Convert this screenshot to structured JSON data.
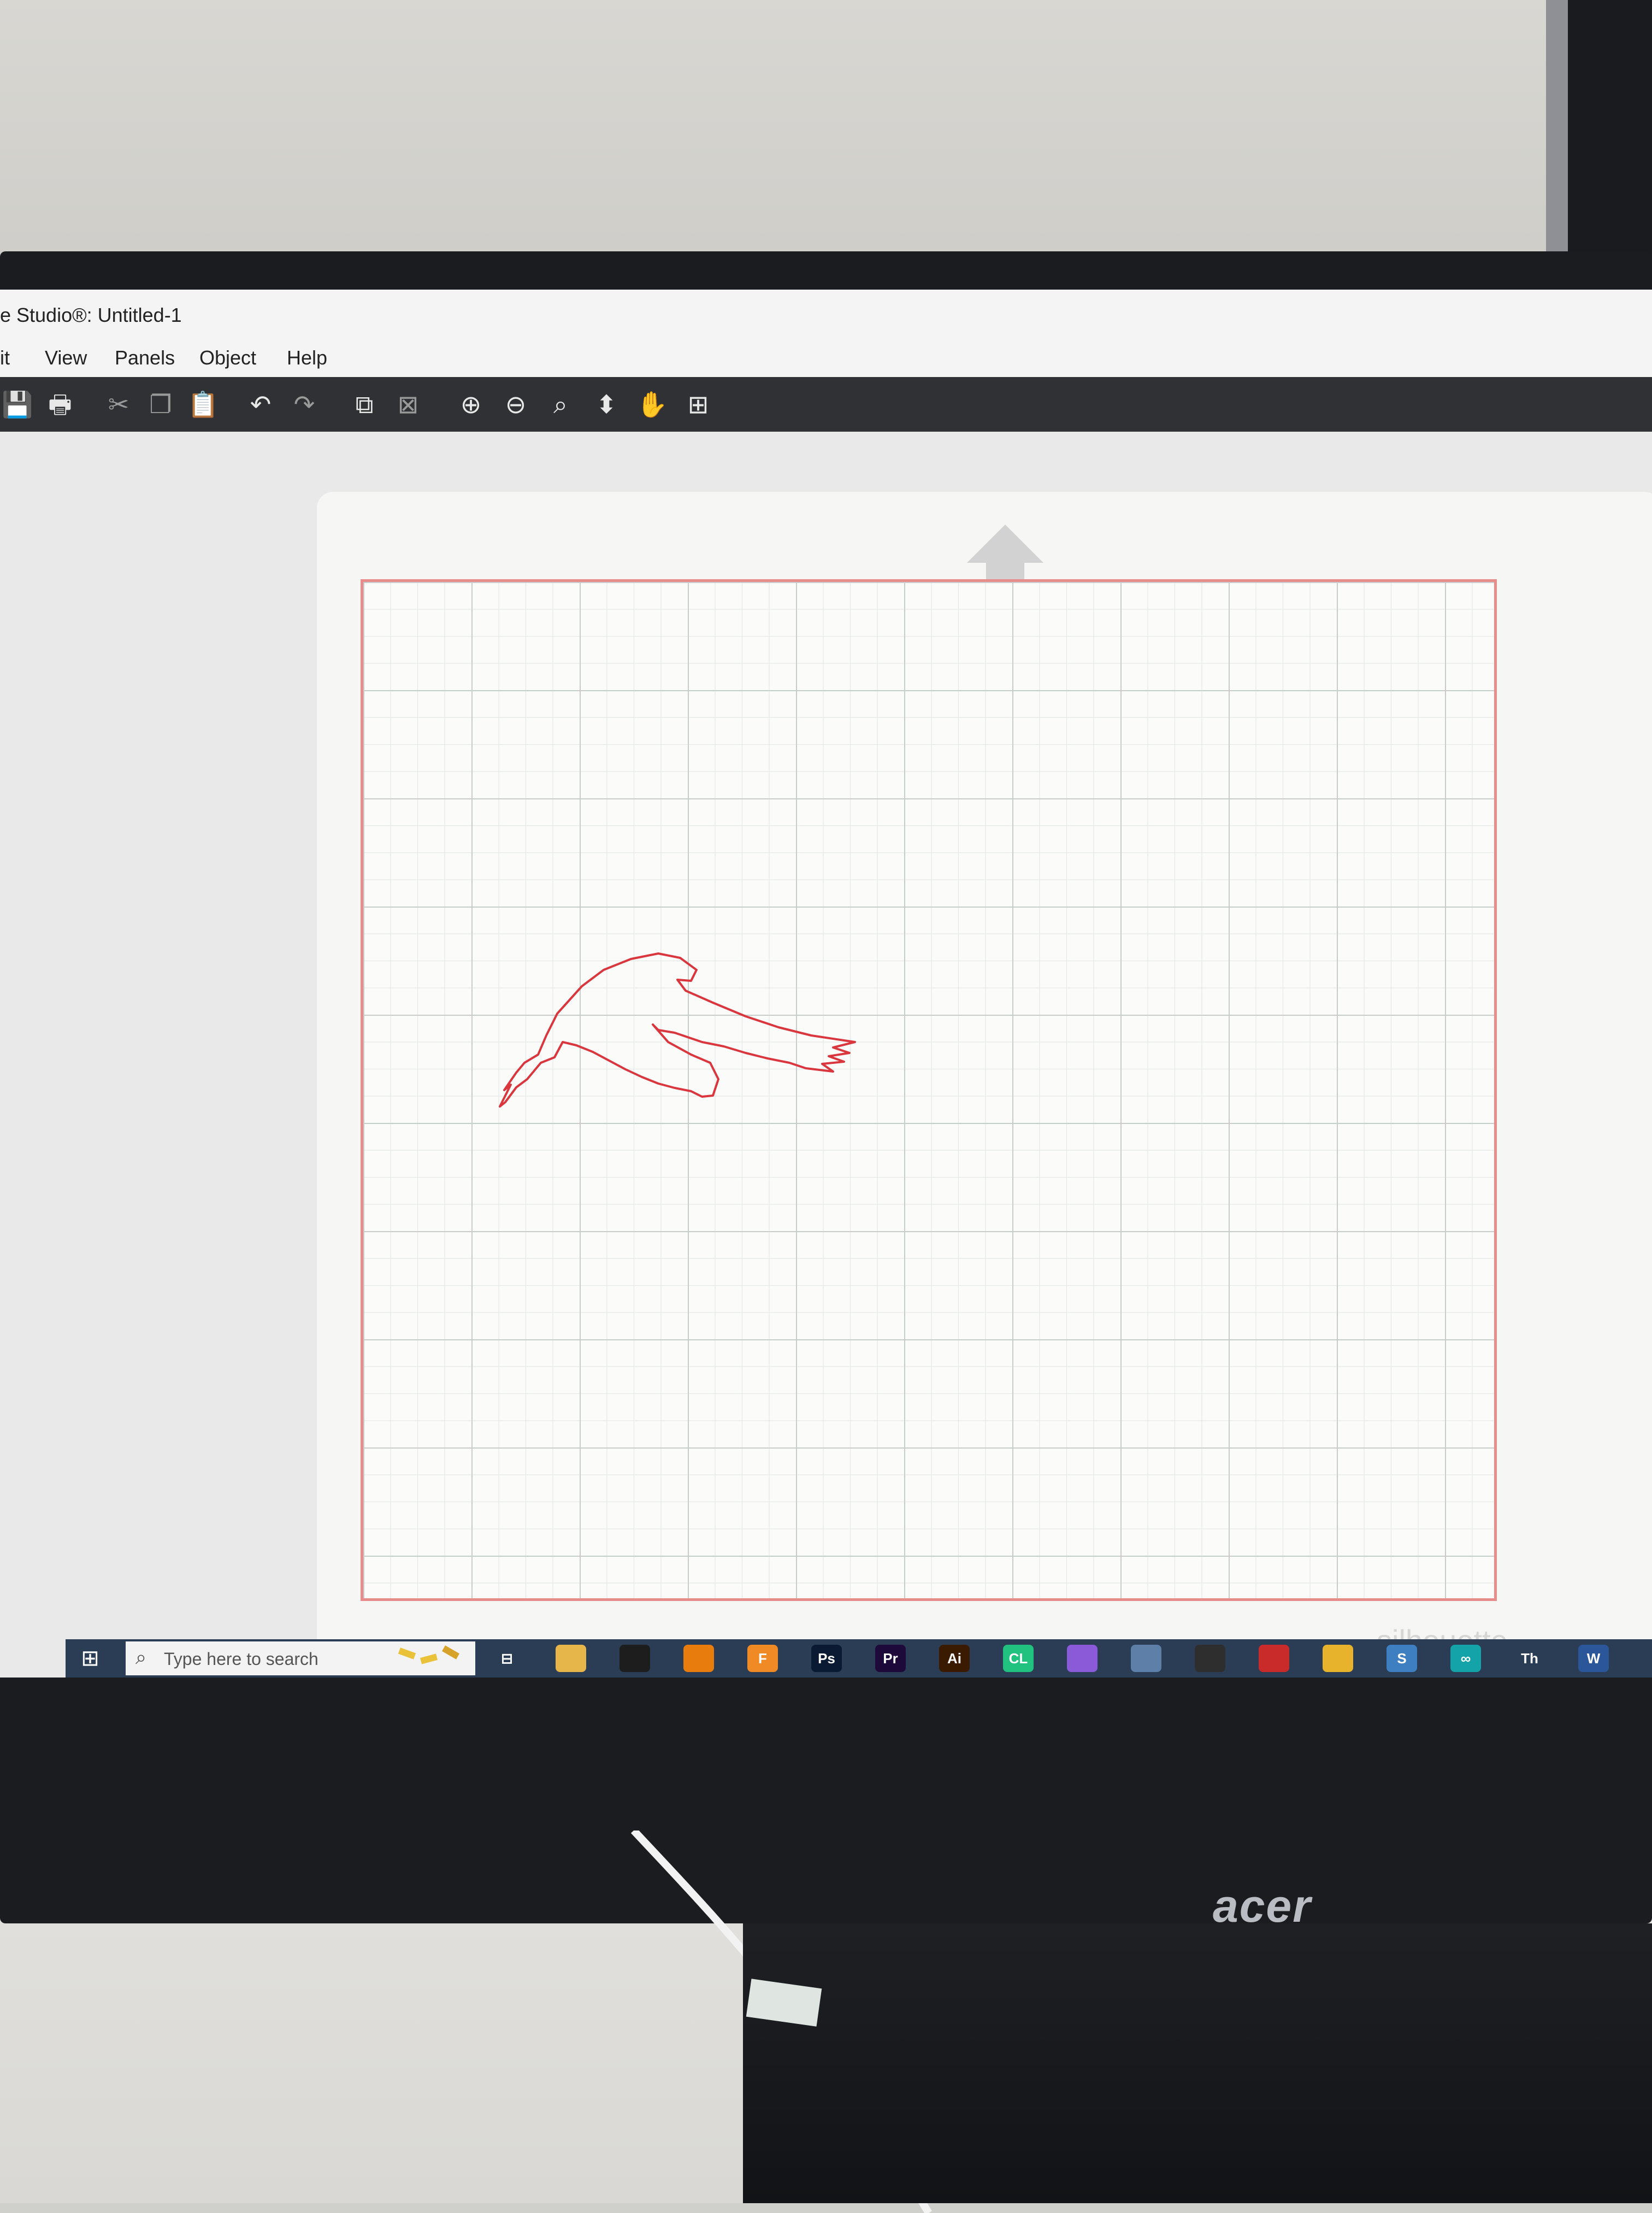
{
  "window": {
    "title": "e Studio®: Untitled-1"
  },
  "menu": {
    "items": [
      "it",
      "View",
      "Panels",
      "Object",
      "Help"
    ]
  },
  "toolbar": {
    "tools": [
      {
        "name": "save-icon",
        "glyph": "💾"
      },
      {
        "name": "print-icon",
        "glyph": "🖶"
      },
      {
        "name": "cut-icon",
        "glyph": "✂"
      },
      {
        "name": "copy-icon",
        "glyph": "❐"
      },
      {
        "name": "paste-icon",
        "glyph": "📋"
      },
      {
        "name": "undo-icon",
        "glyph": "↶"
      },
      {
        "name": "redo-icon",
        "glyph": "↷"
      },
      {
        "name": "group-icon",
        "glyph": "⧉"
      },
      {
        "name": "ungroup-icon",
        "glyph": "⊠"
      },
      {
        "name": "zoom-in-icon",
        "glyph": "⊕"
      },
      {
        "name": "zoom-out-icon",
        "glyph": "⊖"
      },
      {
        "name": "zoom-select-icon",
        "glyph": "⌕"
      },
      {
        "name": "fit-to-page-icon",
        "glyph": "⬍"
      },
      {
        "name": "pan-hand-icon",
        "glyph": "✋"
      },
      {
        "name": "fit-window-icon",
        "glyph": "⊞"
      }
    ]
  },
  "canvas": {
    "cut_line_color": "#d9363e",
    "shape": "flying bird outline"
  },
  "watermark": {
    "text": "silhouette"
  },
  "taskbar": {
    "search_placeholder": "Type here to search",
    "apps": [
      {
        "name": "task-view-icon",
        "label": "⊟",
        "color": "#2b3d55"
      },
      {
        "name": "file-explorer-icon",
        "label": "",
        "color": "#e7b64a"
      },
      {
        "name": "inkscape-icon",
        "label": "",
        "color": "#1d1d1d"
      },
      {
        "name": "blender-icon",
        "label": "",
        "color": "#e87d0d"
      },
      {
        "name": "fusion-icon",
        "label": "F",
        "color": "#f08a24"
      },
      {
        "name": "photoshop-icon",
        "label": "Ps",
        "color": "#0b1a33"
      },
      {
        "name": "premiere-icon",
        "label": "Pr",
        "color": "#1d0a3a"
      },
      {
        "name": "illustrator-icon",
        "label": "Ai",
        "color": "#3a1b00"
      },
      {
        "name": "clion-icon",
        "label": "CL",
        "color": "#21c17f"
      },
      {
        "name": "visual-studio-icon",
        "label": "",
        "color": "#8a5ad9"
      },
      {
        "name": "app-blue-icon",
        "label": "",
        "color": "#5d7fa8"
      },
      {
        "name": "unity-icon",
        "label": "",
        "color": "#2e2e2e"
      },
      {
        "name": "app-red-icon",
        "label": "",
        "color": "#c92a2a"
      },
      {
        "name": "chrome-icon",
        "label": "",
        "color": "#e8b32c"
      },
      {
        "name": "silhouette-icon",
        "label": "S",
        "color": "#3e7fc1"
      },
      {
        "name": "arduino-icon",
        "label": "∞",
        "color": "#13a3a8"
      },
      {
        "name": "text-app-icon",
        "label": "Th",
        "color": "#2b3d55"
      },
      {
        "name": "word-icon",
        "label": "W",
        "color": "#2b579a"
      }
    ]
  },
  "monitor": {
    "brand": "acer"
  }
}
